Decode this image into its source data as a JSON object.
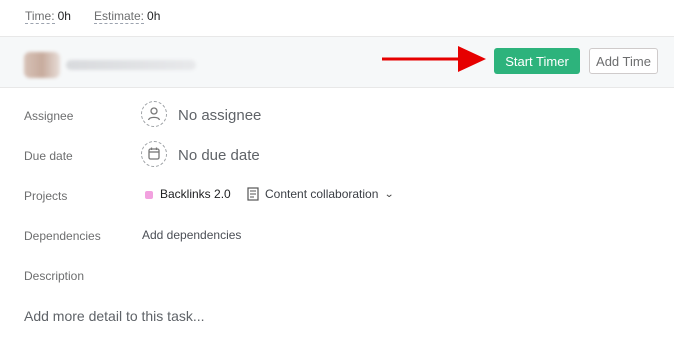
{
  "stats": {
    "time_label": "Time:",
    "time_value": "0h",
    "estimate_label": "Estimate:",
    "estimate_value": "0h"
  },
  "timer": {
    "start_label": "Start Timer",
    "add_label": "Add Time",
    "accent": "#2db37c",
    "arrow_color": "#e60000"
  },
  "fields": {
    "assignee": {
      "label": "Assignee",
      "value": "No assignee",
      "icon": "user-icon"
    },
    "due_date": {
      "label": "Due date",
      "value": "No due date",
      "icon": "calendar-icon"
    },
    "projects": {
      "label": "Projects",
      "project_name": "Backlinks 2.0",
      "project_color": "#f2a1df",
      "section_name": "Content collaboration",
      "section_icon": "document-icon",
      "dropdown_icon": "chevron-down-icon"
    },
    "dependencies": {
      "label": "Dependencies",
      "action": "Add dependencies"
    },
    "description": {
      "label": "Description",
      "placeholder": "Add more detail to this task..."
    }
  }
}
